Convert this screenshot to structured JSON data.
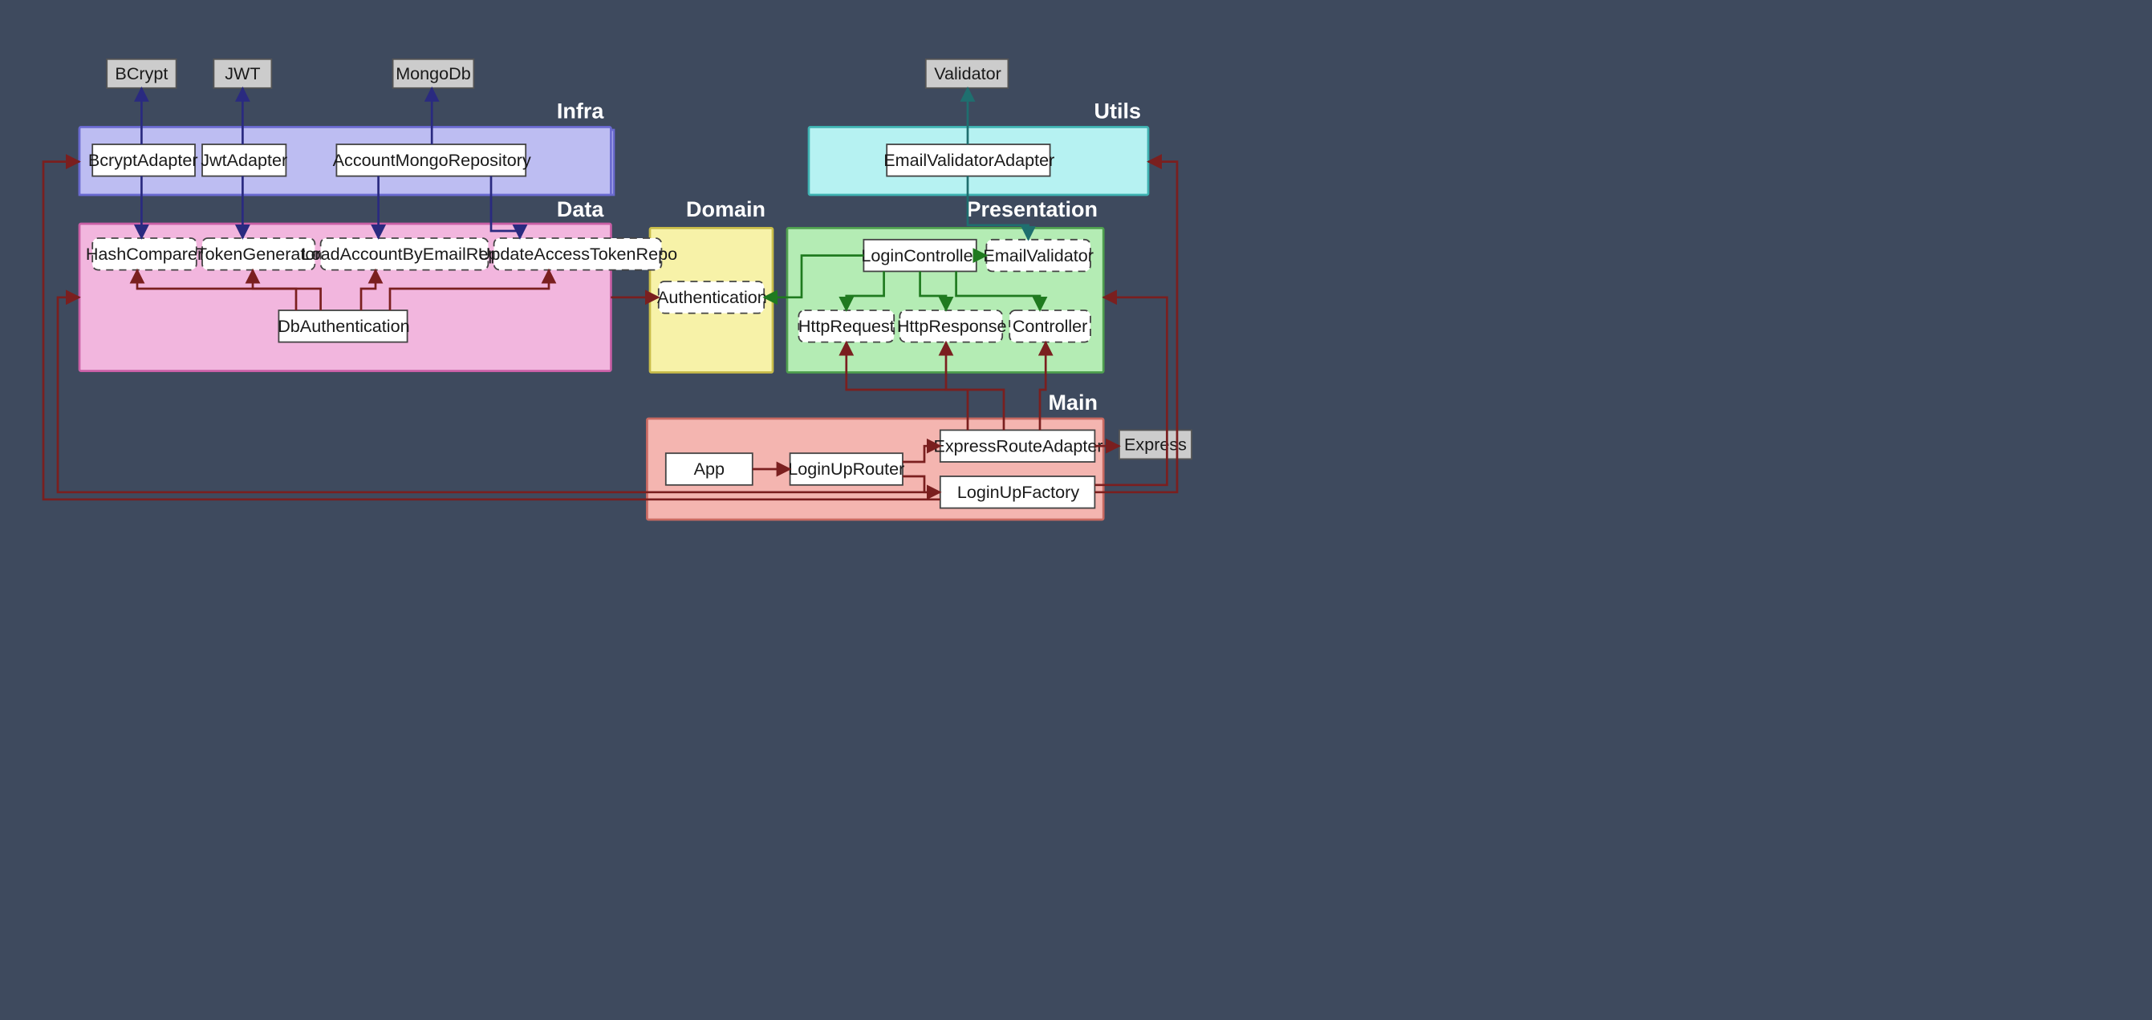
{
  "layers": {
    "infra": {
      "title": "Infra",
      "fill": "#bdbdf2",
      "stroke": "#6a6ad0"
    },
    "data": {
      "title": "Data",
      "fill": "#f2b6de",
      "stroke": "#c95fa5"
    },
    "domain": {
      "title": "Domain",
      "fill": "#f7f2a8",
      "stroke": "#c9bd4a"
    },
    "utils": {
      "title": "Utils",
      "fill": "#b6f2f2",
      "stroke": "#3fb2b2"
    },
    "presentation": {
      "title": "Presentation",
      "fill": "#b4ecb4",
      "stroke": "#4fa04f"
    },
    "main": {
      "title": "Main",
      "fill": "#f4b5b0",
      "stroke": "#c96a62"
    }
  },
  "nodes": {
    "bcrypt": {
      "label": "BCrypt"
    },
    "jwt": {
      "label": "JWT"
    },
    "mongodb": {
      "label": "MongoDb"
    },
    "validator": {
      "label": "Validator"
    },
    "express": {
      "label": "Express"
    },
    "bcryptAdapter": {
      "label": "BcryptAdapter"
    },
    "jwtAdapter": {
      "label": "JwtAdapter"
    },
    "accountMongoRepo": {
      "label": "AccountMongoRepository"
    },
    "hashComparer": {
      "label": "HashComparer"
    },
    "tokenGenerator": {
      "label": "TokenGenerator"
    },
    "loadAccountByEmailRepo": {
      "label": "LoadAccountByEmailRepo"
    },
    "updateAccessTokenRepo": {
      "label": "UpdateAccessTokenRepo"
    },
    "dbAuthentication": {
      "label": "DbAuthentication"
    },
    "authentication": {
      "label": "Authentication"
    },
    "emailValidatorAdapter": {
      "label": "EmailValidatorAdapter"
    },
    "loginController": {
      "label": "LoginController"
    },
    "emailValidator": {
      "label": "EmailValidator"
    },
    "httpRequest": {
      "label": "HttpRequest"
    },
    "httpResponse": {
      "label": "HttpResponse"
    },
    "controller": {
      "label": "Controller"
    },
    "app": {
      "label": "App"
    },
    "loginUpRouter": {
      "label": "LoginUpRouter"
    },
    "expressRouteAdapter": {
      "label": "ExpressRouteAdapter"
    },
    "loginUpFactory": {
      "label": "LoginUpFactory"
    }
  },
  "colors": {
    "darknavy": "#2a2a80",
    "maroon": "#7a1f1f",
    "teal": "#1f6f6f",
    "green": "#1f7a1f"
  }
}
